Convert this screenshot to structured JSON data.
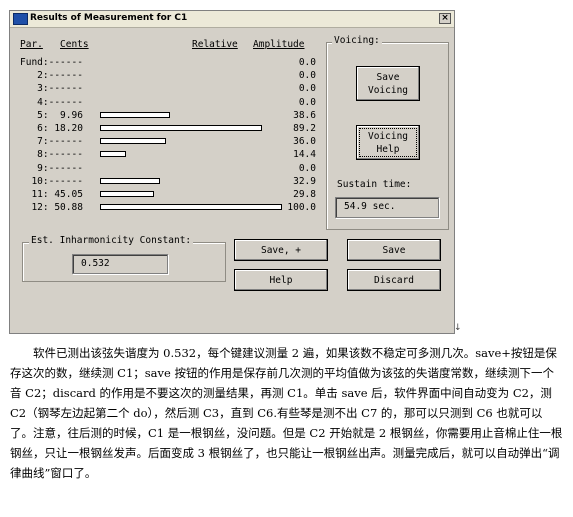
{
  "window": {
    "title": "Results of Measurement for C1",
    "close_label": "×"
  },
  "table": {
    "col_par": "Par.",
    "col_cents": "Cents",
    "col_relative": "Relative",
    "col_amplitude": "Amplitude",
    "rows": [
      {
        "label": "Fund:------",
        "value": "0.0",
        "amplitude": 0.0
      },
      {
        "label": "   2:------",
        "value": "0.0",
        "amplitude": 0.0
      },
      {
        "label": "   3:------",
        "value": "0.0",
        "amplitude": 0.0
      },
      {
        "label": "   4:------",
        "value": "0.0",
        "amplitude": 0.0
      },
      {
        "label": "   5:  9.96",
        "value": "38.6",
        "amplitude": 38.6
      },
      {
        "label": "   6: 18.20",
        "value": "89.2",
        "amplitude": 89.2
      },
      {
        "label": "   7:------",
        "value": "36.0",
        "amplitude": 36.0
      },
      {
        "label": "   8:------",
        "value": "14.4",
        "amplitude": 14.4
      },
      {
        "label": "   9:------",
        "value": "0.0",
        "amplitude": 0.0
      },
      {
        "label": "  10:------",
        "value": "32.9",
        "amplitude": 32.9
      },
      {
        "label": "  11: 45.05",
        "value": "29.8",
        "amplitude": 29.8
      },
      {
        "label": "  12: 50.88",
        "value": "100.0",
        "amplitude": 100.0
      }
    ]
  },
  "voicing": {
    "group_title": "Voicing:",
    "save_voicing": [
      "Save",
      "Voicing"
    ],
    "voicing_help": [
      "Voicing",
      "Help"
    ],
    "sustain_label": "Sustain time:",
    "sustain_value": "54.9 sec."
  },
  "inharmonicity": {
    "group_title": "Est. Inharmonicity Constant:",
    "value": "0.532"
  },
  "buttons": {
    "save_plus": "Save, +",
    "save": "Save",
    "help": "Help",
    "discard": "Discard"
  },
  "caption": {
    "p1": "软件已测出该弦失谐度为 0.532，每个键建议测量 2 遍，如果该数不稳定可多测几次。save+按钮是保存这次的数，继续测 C1；save 按钮的作用是保存前几次测的平均值做为该弦的失谐度常数，继续测下一个音 C2；discard 的作用是不要这次的测量结果，再测 C1。单击 save 后，软件界面中间自动变为 C2，测 C2（钢琴左边起第二个 do），然后测 C3，直到 C6.有些琴是测不出 C7 的，那可以只测到 C6 也就可以了。注意，往后测的时候，C1 是一根钢丝，没问题。但是 C2 开始就是 2 根钢丝，你需要用止音棉止住一根钢丝，只让一根钢丝发声。后面变成 3 根钢丝了，也只能让一根钢丝出声。测量完成后，就可以自动弹出“调律曲线”窗口了。"
  }
}
